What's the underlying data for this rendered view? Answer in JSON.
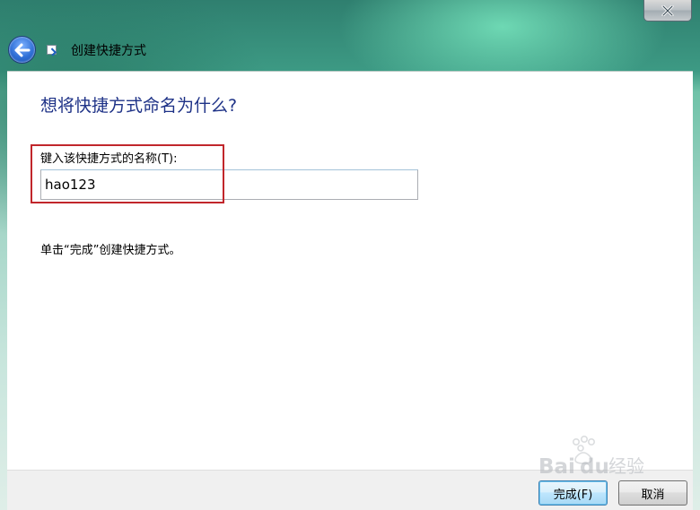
{
  "window": {
    "title": "创建快捷方式",
    "close_icon": "close-icon",
    "back_icon": "back-arrow-icon"
  },
  "main": {
    "heading": "想将快捷方式命名为什么?",
    "field_label": "键入该快捷方式的名称(T):",
    "field_value": "hao123",
    "instruction": "单击“完成”创建快捷方式。"
  },
  "footer": {
    "finish_label": "完成(F)",
    "cancel_label": "取消"
  },
  "watermark": {
    "text": "Baidu经验"
  },
  "colors": {
    "heading": "#1e3287",
    "highlight_box": "#c1262b"
  }
}
